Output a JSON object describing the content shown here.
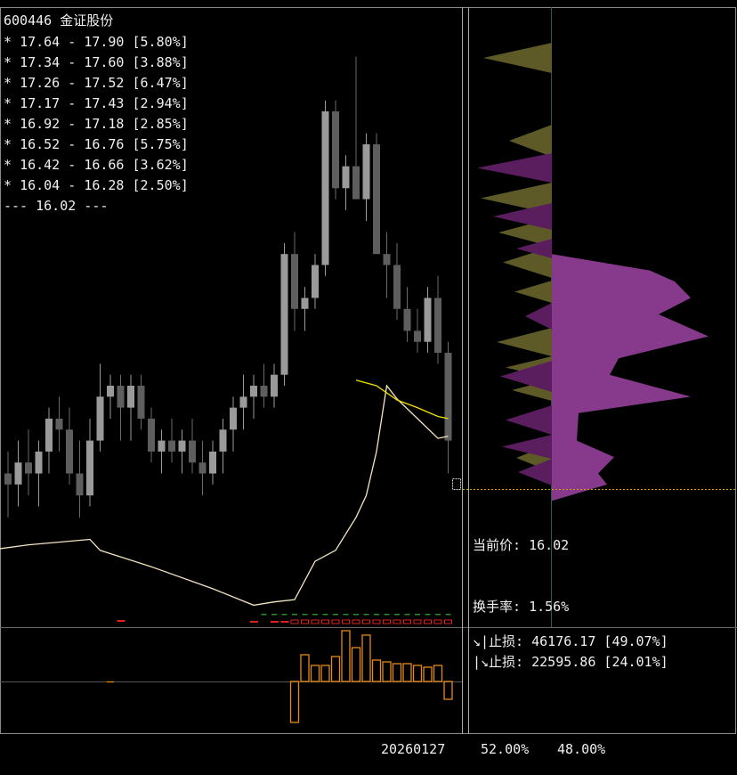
{
  "header": {
    "code": "600446",
    "name": "金证股份"
  },
  "price_levels": [
    {
      "low": "17.64",
      "high": "17.90",
      "pct": "5.80%"
    },
    {
      "low": "17.34",
      "high": "17.60",
      "pct": "3.88%"
    },
    {
      "low": "17.26",
      "high": "17.52",
      "pct": "6.47%"
    },
    {
      "low": "17.17",
      "high": "17.43",
      "pct": "2.94%"
    },
    {
      "low": "16.92",
      "high": "17.18",
      "pct": "2.85%"
    },
    {
      "low": "16.52",
      "high": "16.76",
      "pct": "5.75%"
    },
    {
      "low": "16.42",
      "high": "16.66",
      "pct": "3.62%"
    },
    {
      "low": "16.04",
      "high": "16.28",
      "pct": "2.50%"
    }
  ],
  "current_line": "--- 16.02 ---",
  "info": {
    "current_price_label": "当前价:",
    "current_price": "16.02",
    "turnover_label": "换手率:",
    "turnover": "1.56%"
  },
  "stops": [
    {
      "prefix": "↘|止损:",
      "value": "46176.17",
      "pct": "49.07%"
    },
    {
      "prefix": "|↘止损:",
      "value": "22595.86",
      "pct": "24.01%"
    }
  ],
  "footer": {
    "date": "20260127",
    "pct_left": "52.00%",
    "pct_right": "48.00%"
  },
  "colors": {
    "background": "#000000",
    "candle": "#8c8c8c",
    "ma_yellow": "#f2e300",
    "ma_cream": "#f5e6c3",
    "profile_purple": "#8e3c92",
    "profile_olive": "#5e5a28",
    "price_line": "#d9a400",
    "histogram": "#e38a17",
    "red_marker": "#e02020",
    "green_marker": "#2e8b2e"
  },
  "chart_data": {
    "type": "candlestick",
    "candles": [
      [
        16.3,
        16.5,
        15.9,
        16.2
      ],
      [
        16.2,
        16.6,
        16.0,
        16.4
      ],
      [
        16.4,
        16.7,
        16.1,
        16.3
      ],
      [
        16.3,
        16.6,
        16.0,
        16.5
      ],
      [
        16.5,
        16.9,
        16.3,
        16.8
      ],
      [
        16.8,
        17.0,
        16.5,
        16.7
      ],
      [
        16.7,
        16.9,
        16.2,
        16.3
      ],
      [
        16.3,
        16.6,
        15.9,
        16.1
      ],
      [
        16.1,
        16.8,
        16.0,
        16.6
      ],
      [
        16.6,
        17.3,
        16.5,
        17.0
      ],
      [
        17.0,
        17.2,
        16.8,
        17.1
      ],
      [
        17.1,
        17.2,
        16.6,
        16.9
      ],
      [
        16.9,
        17.2,
        16.6,
        17.1
      ],
      [
        17.1,
        17.2,
        16.7,
        16.8
      ],
      [
        16.8,
        16.9,
        16.4,
        16.5
      ],
      [
        16.5,
        16.7,
        16.3,
        16.6
      ],
      [
        16.6,
        16.8,
        16.4,
        16.5
      ],
      [
        16.5,
        16.7,
        16.3,
        16.6
      ],
      [
        16.6,
        16.8,
        16.3,
        16.4
      ],
      [
        16.4,
        16.6,
        16.1,
        16.3
      ],
      [
        16.3,
        16.6,
        16.2,
        16.5
      ],
      [
        16.5,
        16.8,
        16.3,
        16.7
      ],
      [
        16.7,
        17.0,
        16.5,
        16.9
      ],
      [
        16.9,
        17.2,
        16.7,
        17.0
      ],
      [
        17.0,
        17.2,
        16.8,
        17.1
      ],
      [
        17.1,
        17.3,
        16.9,
        17.0
      ],
      [
        17.0,
        17.3,
        16.9,
        17.2
      ],
      [
        17.2,
        18.4,
        17.1,
        18.3
      ],
      [
        18.3,
        18.5,
        17.6,
        17.8
      ],
      [
        17.8,
        18.0,
        17.6,
        17.9
      ],
      [
        17.9,
        18.3,
        17.8,
        18.2
      ],
      [
        18.2,
        19.7,
        18.1,
        19.6
      ],
      [
        19.6,
        19.7,
        18.8,
        18.9
      ],
      [
        18.9,
        19.2,
        18.7,
        19.1
      ],
      [
        19.1,
        20.1,
        18.8,
        18.8
      ],
      [
        18.8,
        19.4,
        18.6,
        19.3
      ],
      [
        19.3,
        19.4,
        18.3,
        18.3
      ],
      [
        18.3,
        18.5,
        17.9,
        18.2
      ],
      [
        18.2,
        18.4,
        17.7,
        17.8
      ],
      [
        17.8,
        18.0,
        17.5,
        17.6
      ],
      [
        17.6,
        17.8,
        17.4,
        17.5
      ],
      [
        17.5,
        18.0,
        17.4,
        17.9
      ],
      [
        17.9,
        18.1,
        17.3,
        17.4
      ],
      [
        17.4,
        17.5,
        16.3,
        16.6
      ]
    ],
    "ma_yellow": [
      [
        34,
        17.15
      ],
      [
        36,
        17.1
      ],
      [
        38,
        16.97
      ],
      [
        40,
        16.9
      ],
      [
        42,
        16.82
      ],
      [
        43,
        16.8
      ]
    ],
    "ma_cream": [
      [
        -2,
        15.6
      ],
      [
        2,
        15.65
      ],
      [
        8,
        15.7
      ],
      [
        9,
        15.6
      ],
      [
        14,
        15.45
      ],
      [
        20,
        15.25
      ],
      [
        24,
        15.1
      ],
      [
        26,
        15.13
      ],
      [
        28,
        15.15
      ],
      [
        30,
        15.5
      ],
      [
        32,
        15.6
      ],
      [
        34,
        15.9
      ],
      [
        35,
        16.1
      ],
      [
        36,
        16.5
      ],
      [
        37,
        17.1
      ],
      [
        38,
        16.98
      ],
      [
        40,
        16.8
      ],
      [
        42,
        16.62
      ],
      [
        43,
        16.64
      ]
    ],
    "volume_profile_purple": [
      [
        16.05,
        0.0
      ],
      [
        16.2,
        62
      ],
      [
        16.3,
        52
      ],
      [
        16.45,
        70
      ],
      [
        16.6,
        28
      ],
      [
        16.85,
        30
      ],
      [
        17.0,
        156
      ],
      [
        17.2,
        65
      ],
      [
        17.35,
        75
      ],
      [
        17.55,
        176
      ],
      [
        17.75,
        120
      ],
      [
        17.9,
        156
      ],
      [
        18.05,
        138
      ],
      [
        18.15,
        110
      ],
      [
        18.3,
        0
      ]
    ],
    "histogram": [
      0,
      0,
      0,
      0,
      0,
      0,
      0,
      0,
      0,
      0,
      0,
      0,
      0,
      0,
      0,
      0,
      0,
      0,
      0,
      0,
      0,
      0,
      0,
      0,
      0,
      0,
      0,
      0,
      -46,
      30,
      18,
      18,
      28,
      57,
      38,
      52,
      24,
      22,
      20,
      20,
      18,
      16,
      18,
      -20
    ],
    "ylim": [
      14.9,
      20.55
    ]
  }
}
